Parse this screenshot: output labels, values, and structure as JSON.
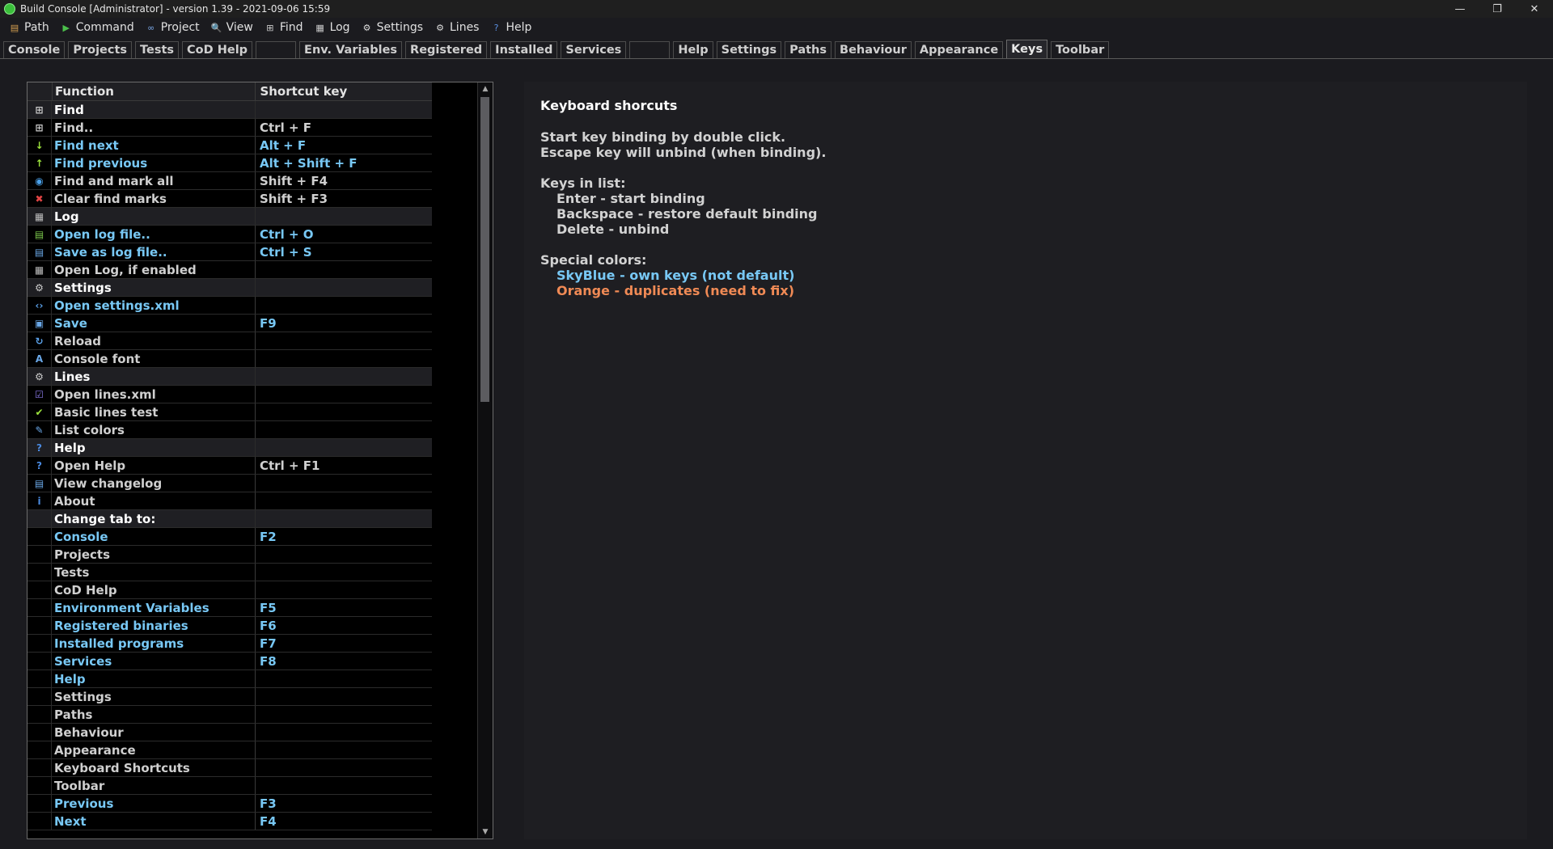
{
  "window": {
    "title": "Build Console [Administrator] - version 1.39 - 2021-09-06 15:59"
  },
  "menu": [
    {
      "label": "Path",
      "icon": "path-icon",
      "color": "#d8a050",
      "glyph": "▤"
    },
    {
      "label": "Command",
      "icon": "command-icon",
      "color": "#4bbf4b",
      "glyph": "▶"
    },
    {
      "label": "Project",
      "icon": "project-icon",
      "color": "#7aa8e8",
      "glyph": "∞"
    },
    {
      "label": "View",
      "icon": "view-icon",
      "color": "#9bc4ee",
      "glyph": "🔍"
    },
    {
      "label": "Find",
      "icon": "binoculars-icon",
      "color": "#cccccc",
      "glyph": "⊞"
    },
    {
      "label": "Log",
      "icon": "log-icon",
      "color": "#cccccc",
      "glyph": "▦"
    },
    {
      "label": "Settings",
      "icon": "gear-icon",
      "color": "#dddddd",
      "glyph": "⚙"
    },
    {
      "label": "Lines",
      "icon": "lines-icon",
      "color": "#dddddd",
      "glyph": "⚙"
    },
    {
      "label": "Help",
      "icon": "help-icon",
      "color": "#5a8fe0",
      "glyph": "?"
    }
  ],
  "tabs": [
    {
      "label": "Console"
    },
    {
      "label": "Projects"
    },
    {
      "label": "Tests"
    },
    {
      "label": "CoD Help"
    },
    {
      "label": ""
    },
    {
      "label": "Env. Variables"
    },
    {
      "label": "Registered"
    },
    {
      "label": "Installed"
    },
    {
      "label": "Services"
    },
    {
      "label": ""
    },
    {
      "label": "Help"
    },
    {
      "label": "Settings"
    },
    {
      "label": "Paths"
    },
    {
      "label": "Behaviour"
    },
    {
      "label": "Appearance"
    },
    {
      "label": "Keys",
      "active": true
    },
    {
      "label": "Toolbar"
    }
  ],
  "list": {
    "header": {
      "function": "Function",
      "shortcut": "Shortcut key"
    },
    "rows": [
      {
        "type": "group",
        "icon": "binoculars-icon",
        "glyph": "⊞",
        "icolor": "#cccccc",
        "func": "Find",
        "key": ""
      },
      {
        "type": "def",
        "icon": "binoculars-icon",
        "glyph": "⊞",
        "icolor": "#cccccc",
        "func": "Find..",
        "key": "Ctrl + F"
      },
      {
        "type": "sky",
        "icon": "arrow-down-icon",
        "glyph": "↓",
        "icolor": "#9be23c",
        "func": "Find next",
        "key": "Alt + F"
      },
      {
        "type": "sky",
        "icon": "arrow-up-icon",
        "glyph": "↑",
        "icolor": "#9be23c",
        "func": "Find previous",
        "key": "Alt + Shift + F"
      },
      {
        "type": "def",
        "icon": "mark-all-icon",
        "glyph": "◉",
        "icolor": "#4aa0e8",
        "func": "Find and mark all",
        "key": "Shift + F4"
      },
      {
        "type": "def",
        "icon": "clear-icon",
        "glyph": "✖",
        "icolor": "#e24444",
        "func": "Clear find marks",
        "key": "Shift + F3"
      },
      {
        "type": "group",
        "icon": "log-icon",
        "glyph": "▦",
        "icolor": "#bbbbbb",
        "func": "Log",
        "key": ""
      },
      {
        "type": "sky",
        "icon": "open-log-icon",
        "glyph": "▤",
        "icolor": "#7cc84c",
        "func": "Open log file..",
        "key": "Ctrl + O"
      },
      {
        "type": "sky",
        "icon": "save-log-icon",
        "glyph": "▤",
        "icolor": "#6aa8e8",
        "func": "Save as log file..",
        "key": "Ctrl + S"
      },
      {
        "type": "def",
        "icon": "log-icon",
        "glyph": "▦",
        "icolor": "#bbbbbb",
        "func": "Open Log, if enabled",
        "key": ""
      },
      {
        "type": "group",
        "icon": "gear-icon",
        "glyph": "⚙",
        "icolor": "#cccccc",
        "func": "Settings",
        "key": ""
      },
      {
        "type": "sky",
        "icon": "code-icon",
        "glyph": "‹›",
        "icolor": "#5aa0e8",
        "func": "Open settings.xml",
        "key": ""
      },
      {
        "type": "sky",
        "icon": "save-icon",
        "glyph": "▣",
        "icolor": "#6aa8e8",
        "func": "Save",
        "key": "F9"
      },
      {
        "type": "def",
        "icon": "reload-icon",
        "glyph": "↻",
        "icolor": "#5aa0e8",
        "func": "Reload",
        "key": ""
      },
      {
        "type": "def",
        "icon": "font-icon",
        "glyph": "A",
        "icolor": "#6aa8e8",
        "func": "Console font",
        "key": ""
      },
      {
        "type": "group",
        "icon": "lines-icon",
        "glyph": "⚙",
        "icolor": "#cccccc",
        "func": "Lines",
        "key": ""
      },
      {
        "type": "def",
        "icon": "checkbox-icon",
        "glyph": "☑",
        "icolor": "#8a7ae8",
        "func": "Open lines.xml",
        "key": ""
      },
      {
        "type": "def",
        "icon": "check-icon",
        "glyph": "✔",
        "icolor": "#9be23c",
        "func": "Basic lines test",
        "key": ""
      },
      {
        "type": "def",
        "icon": "palette-icon",
        "glyph": "✎",
        "icolor": "#6aa8e8",
        "func": "List colors",
        "key": ""
      },
      {
        "type": "group",
        "icon": "help-icon",
        "glyph": "?",
        "icolor": "#4a8ae0",
        "func": "Help",
        "key": ""
      },
      {
        "type": "def",
        "icon": "help-icon",
        "glyph": "?",
        "icolor": "#4a8ae0",
        "func": "Open Help",
        "key": "Ctrl + F1"
      },
      {
        "type": "def",
        "icon": "changelog-icon",
        "glyph": "▤",
        "icolor": "#6aa8e8",
        "func": "View changelog",
        "key": ""
      },
      {
        "type": "def",
        "icon": "info-icon",
        "glyph": "i",
        "icolor": "#4a8ae0",
        "func": "About",
        "key": ""
      },
      {
        "type": "group",
        "icon": "",
        "glyph": "",
        "icolor": "#cccccc",
        "func": "Change tab to:",
        "key": ""
      },
      {
        "type": "sky",
        "icon": "",
        "glyph": "",
        "icolor": "#cccccc",
        "func": "Console",
        "key": "F2"
      },
      {
        "type": "def",
        "icon": "",
        "glyph": "",
        "icolor": "#cccccc",
        "func": "Projects",
        "key": ""
      },
      {
        "type": "def",
        "icon": "",
        "glyph": "",
        "icolor": "#cccccc",
        "func": "Tests",
        "key": ""
      },
      {
        "type": "def",
        "icon": "",
        "glyph": "",
        "icolor": "#cccccc",
        "func": "CoD Help",
        "key": ""
      },
      {
        "type": "sky",
        "icon": "",
        "glyph": "",
        "icolor": "#cccccc",
        "func": "Environment Variables",
        "key": "F5"
      },
      {
        "type": "sky",
        "icon": "",
        "glyph": "",
        "icolor": "#cccccc",
        "func": "Registered binaries",
        "key": "F6"
      },
      {
        "type": "sky",
        "icon": "",
        "glyph": "",
        "icolor": "#cccccc",
        "func": "Installed programs",
        "key": "F7"
      },
      {
        "type": "sky",
        "icon": "",
        "glyph": "",
        "icolor": "#cccccc",
        "func": "Services",
        "key": "F8"
      },
      {
        "type": "sky",
        "icon": "",
        "glyph": "",
        "icolor": "#cccccc",
        "func": "Help",
        "key": ""
      },
      {
        "type": "def",
        "icon": "",
        "glyph": "",
        "icolor": "#cccccc",
        "func": "Settings",
        "key": ""
      },
      {
        "type": "def",
        "icon": "",
        "glyph": "",
        "icolor": "#cccccc",
        "func": "Paths",
        "key": ""
      },
      {
        "type": "def",
        "icon": "",
        "glyph": "",
        "icolor": "#cccccc",
        "func": "Behaviour",
        "key": ""
      },
      {
        "type": "def",
        "icon": "",
        "glyph": "",
        "icolor": "#cccccc",
        "func": "Appearance",
        "key": ""
      },
      {
        "type": "def",
        "icon": "",
        "glyph": "",
        "icolor": "#cccccc",
        "func": "Keyboard Shortcuts",
        "key": ""
      },
      {
        "type": "def",
        "icon": "",
        "glyph": "",
        "icolor": "#cccccc",
        "func": "Toolbar",
        "key": ""
      },
      {
        "type": "sky",
        "icon": "",
        "glyph": "",
        "icolor": "#cccccc",
        "func": "Previous",
        "key": "F3"
      },
      {
        "type": "sky",
        "icon": "",
        "glyph": "",
        "icolor": "#cccccc",
        "func": "Next",
        "key": "F4"
      }
    ]
  },
  "info": {
    "title": "Keyboard shorcuts",
    "line1": "Start key binding by double click.",
    "line2": "Escape key will unbind (when binding).",
    "keys_heading": "Keys in list:",
    "key_enter": "Enter - start binding",
    "key_backspace": "Backspace - restore default binding",
    "key_delete": "Delete - unbind",
    "colors_heading": "Special colors:",
    "color_skyblue": "SkyBlue - own keys (not default)",
    "color_orange": "Orange - duplicates (need to fix)"
  },
  "colors": {
    "skyblue": "#78c8f5",
    "orange": "#f08a55",
    "background": "#1b1b1f"
  }
}
